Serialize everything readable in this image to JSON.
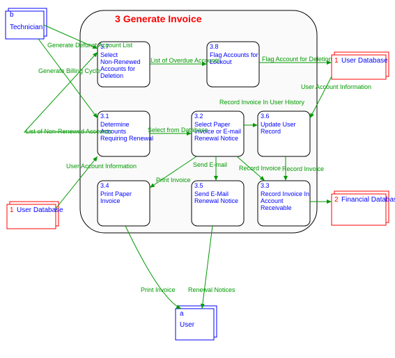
{
  "main": {
    "id": "3",
    "title": "Generate Invoice"
  },
  "externals": {
    "tech": {
      "id": "b",
      "label": "Technician"
    },
    "udb_left": {
      "id": "1",
      "label": "User Database"
    },
    "udb_right": {
      "id": "1",
      "label": "User Database"
    },
    "fdb": {
      "id": "2",
      "label": "Financial Database"
    },
    "user": {
      "id": "a",
      "label": "User"
    }
  },
  "procs": {
    "p37": {
      "id": "3.7",
      "l1": "Select",
      "l2": "Non-Renewed",
      "l3": "Accounts for",
      "l4": "Deletion"
    },
    "p38": {
      "id": "3.8",
      "l1": "Flag Accounts for",
      "l2": "Lockout"
    },
    "p31": {
      "id": "3.1",
      "l1": "Determine",
      "l2": "Accounts",
      "l3": "Requiring Renewal"
    },
    "p32": {
      "id": "3.2",
      "l1": "Select Paper",
      "l2": "Invoice or E-mail",
      "l3": "Renewal Notice"
    },
    "p36": {
      "id": "3.6",
      "l1": "Update User",
      "l2": "Record"
    },
    "p34": {
      "id": "3.4",
      "l1": "Print Paper",
      "l2": "Invoice"
    },
    "p35": {
      "id": "3.5",
      "l1": "Send E-Mail",
      "l2": "Renewal Notice"
    },
    "p33": {
      "id": "3.3",
      "l1": "Record Invoice In",
      "l2": "Account",
      "l3": "Receivable"
    }
  },
  "flows": {
    "gen_defunct": "Generate Defunct Account List",
    "gen_billing": "Generate Billing Cycle",
    "list_overdue": "List of Overdue Accounts",
    "flag_del": "Flag Account for Deletion",
    "user_acct_r": "User Account Information",
    "rec_hist": "Record Invoice In User History",
    "list_nonren": "List of Non-Renewed Accounts",
    "select_db": "Select from Database",
    "user_acct_l": "User Account Information",
    "print_inv": "Print Invoice",
    "send_em": "Send E-mail",
    "rec_inv1": "Record Invoice",
    "rec_inv2": "Record Invoice",
    "print_inv2": "Print Invoice",
    "renewal": "Renewal Notices"
  }
}
